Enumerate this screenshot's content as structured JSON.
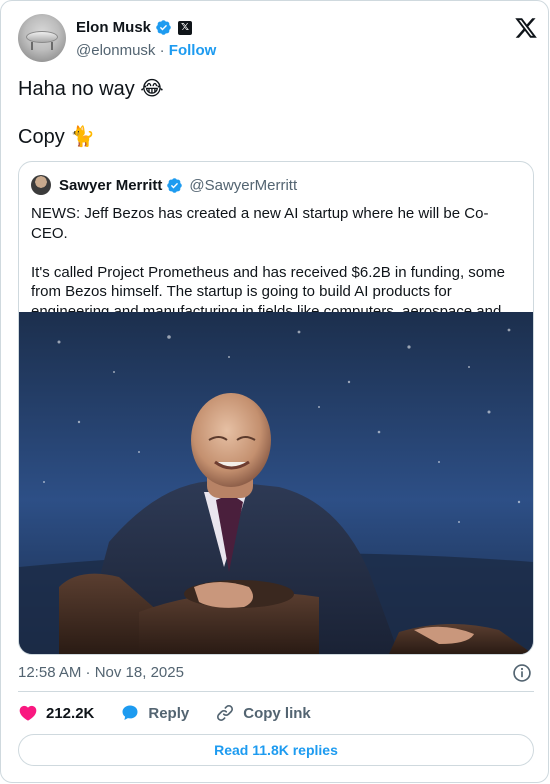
{
  "author": {
    "name": "Elon Musk",
    "handle": "@elonmusk",
    "separator": "·",
    "follow_label": "Follow"
  },
  "tweet": {
    "text": "Haha no way 😂\n\nCopy 🐈"
  },
  "quote": {
    "name": "Sawyer Merritt",
    "handle": "@SawyerMerritt",
    "text": "NEWS: Jeff Bezos has created a new AI startup where he will be Co-CEO.\n\nIt's called Project Prometheus and has received $6.2B in funding, some from Bezos himself. The startup is going to build AI products for engineering and manufacturing in fields like computers, aerospace and"
  },
  "timestamp": "12:58 AM · Nov 18, 2025",
  "actions": {
    "likes": "212.2K",
    "reply_label": "Reply",
    "copy_link_label": "Copy link"
  },
  "read_replies_label": "Read 11.8K replies",
  "colors": {
    "accent": "#1d9bf0",
    "like": "#f91880",
    "text": "#0f1419",
    "secondary": "#536471",
    "border": "#cfd9de"
  },
  "icons": [
    "verified-badge-icon",
    "x-badge-icon",
    "x-logo-icon",
    "info-icon",
    "heart-icon",
    "reply-bubble-icon",
    "link-icon"
  ]
}
